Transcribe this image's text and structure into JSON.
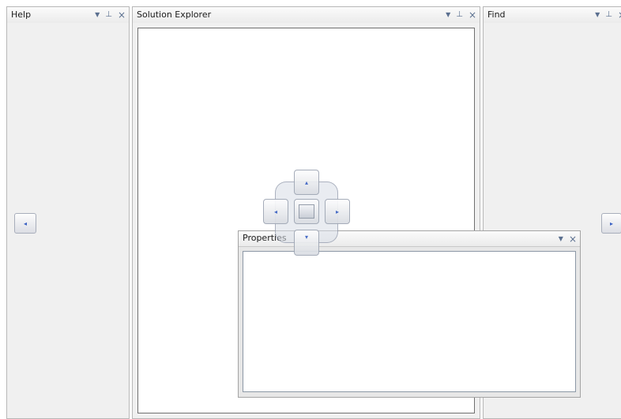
{
  "panes": {
    "help": {
      "title": "Help",
      "dropdown_icon": "▼",
      "pin_icon": "⊥",
      "close_icon": "×",
      "arrow_icon": "◂"
    },
    "solution_explorer": {
      "title": "Solution Explorer",
      "dropdown_icon": "▼",
      "pin_icon": "⊥",
      "close_icon": "×"
    },
    "find": {
      "title": "Find",
      "dropdown_icon": "▼",
      "pin_icon": "⊥",
      "close_icon": "×",
      "arrow_icon": "▸"
    }
  },
  "floating_window": {
    "title": "Properties",
    "dropdown_icon": "▼",
    "close_icon": "×"
  },
  "dock_guide": {
    "up": "▴",
    "down": "▾",
    "left": "◂",
    "right": "▸"
  },
  "colors": {
    "accent": "#3b62c4",
    "header_icons": "#5a6f8f",
    "pane_bg": "#f0f0f0"
  }
}
